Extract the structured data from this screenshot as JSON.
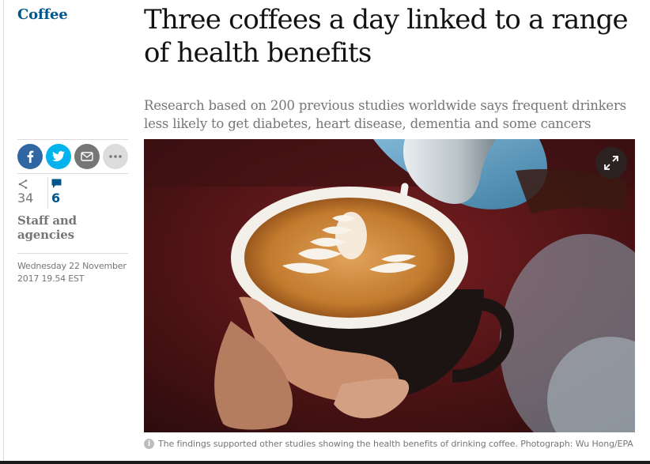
{
  "article": {
    "section": "Coffee",
    "headline": "Three coffees a day linked to a range of health benefits",
    "standfirst": "Research based on 200 previous studies worldwide says frequent drinkers less likely to get diabetes, heart disease, dementia and some cancers",
    "byline": "Staff and agencies",
    "date_line1": "Wednesday 22 November",
    "date_line2": "2017 19.54 EST"
  },
  "share": {
    "buttons": [
      "facebook-icon",
      "twitter-icon",
      "email-icon",
      "more-icon"
    ],
    "share_count": "34",
    "comment_count": "6"
  },
  "image": {
    "caption": "The findings supported other studies showing the health benefits of drinking coffee. Photograph: Wu Hong/EPA"
  },
  "colors": {
    "section": "#005689",
    "facebook": "#3067a3",
    "twitter": "#03b3ee",
    "email": "#767676",
    "comments": "#005689"
  }
}
